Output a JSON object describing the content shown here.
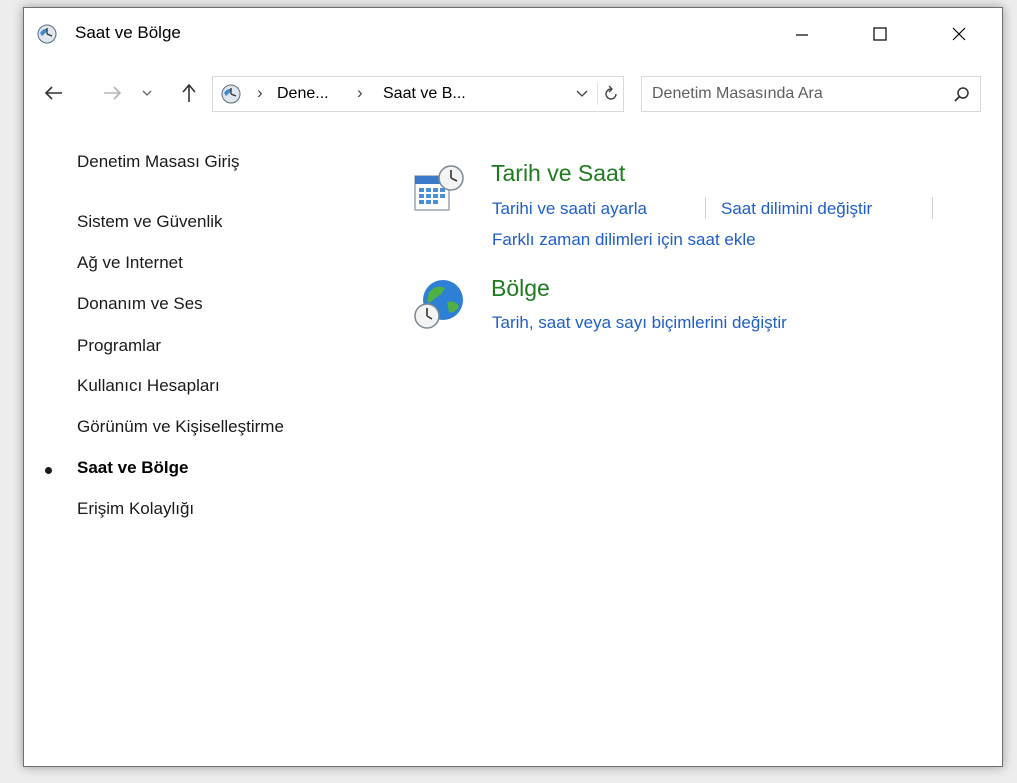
{
  "window": {
    "title": "Saat ve Bölge",
    "icon": "clock-globe-icon",
    "controls": [
      "minimize-icon",
      "maximize-icon",
      "close-icon"
    ]
  },
  "navbar": {
    "breadcrumbs": [
      "Dene...",
      "Saat ve B..."
    ],
    "search_placeholder": "Denetim Masasında Ara"
  },
  "sidebar": {
    "home": "Denetim Masası Giriş",
    "items": [
      {
        "label": "Sistem ve Güvenlik"
      },
      {
        "label": "Ağ ve Internet"
      },
      {
        "label": "Donanım ve Ses"
      },
      {
        "label": "Programlar"
      },
      {
        "label": "Kullanıcı Hesapları"
      },
      {
        "label": "Görünüm ve Kişiselleştirme"
      },
      {
        "label": "Saat ve Bölge",
        "active": true
      },
      {
        "label": "Erişim Kolaylığı"
      }
    ]
  },
  "main": {
    "categories": [
      {
        "title": "Tarih ve Saat",
        "icon": "calendar-clock-icon",
        "links": [
          "Tarihi ve saati ayarla",
          "Saat dilimini değiştir",
          "Farklı zaman dilimleri için saat ekle"
        ]
      },
      {
        "title": "Bölge",
        "icon": "globe-clock-icon",
        "links": [
          "Tarih, saat veya sayı biçimlerini değiştir"
        ]
      }
    ]
  },
  "colors": {
    "category_title": "#1e7b1e",
    "link": "#1e5fc9"
  }
}
